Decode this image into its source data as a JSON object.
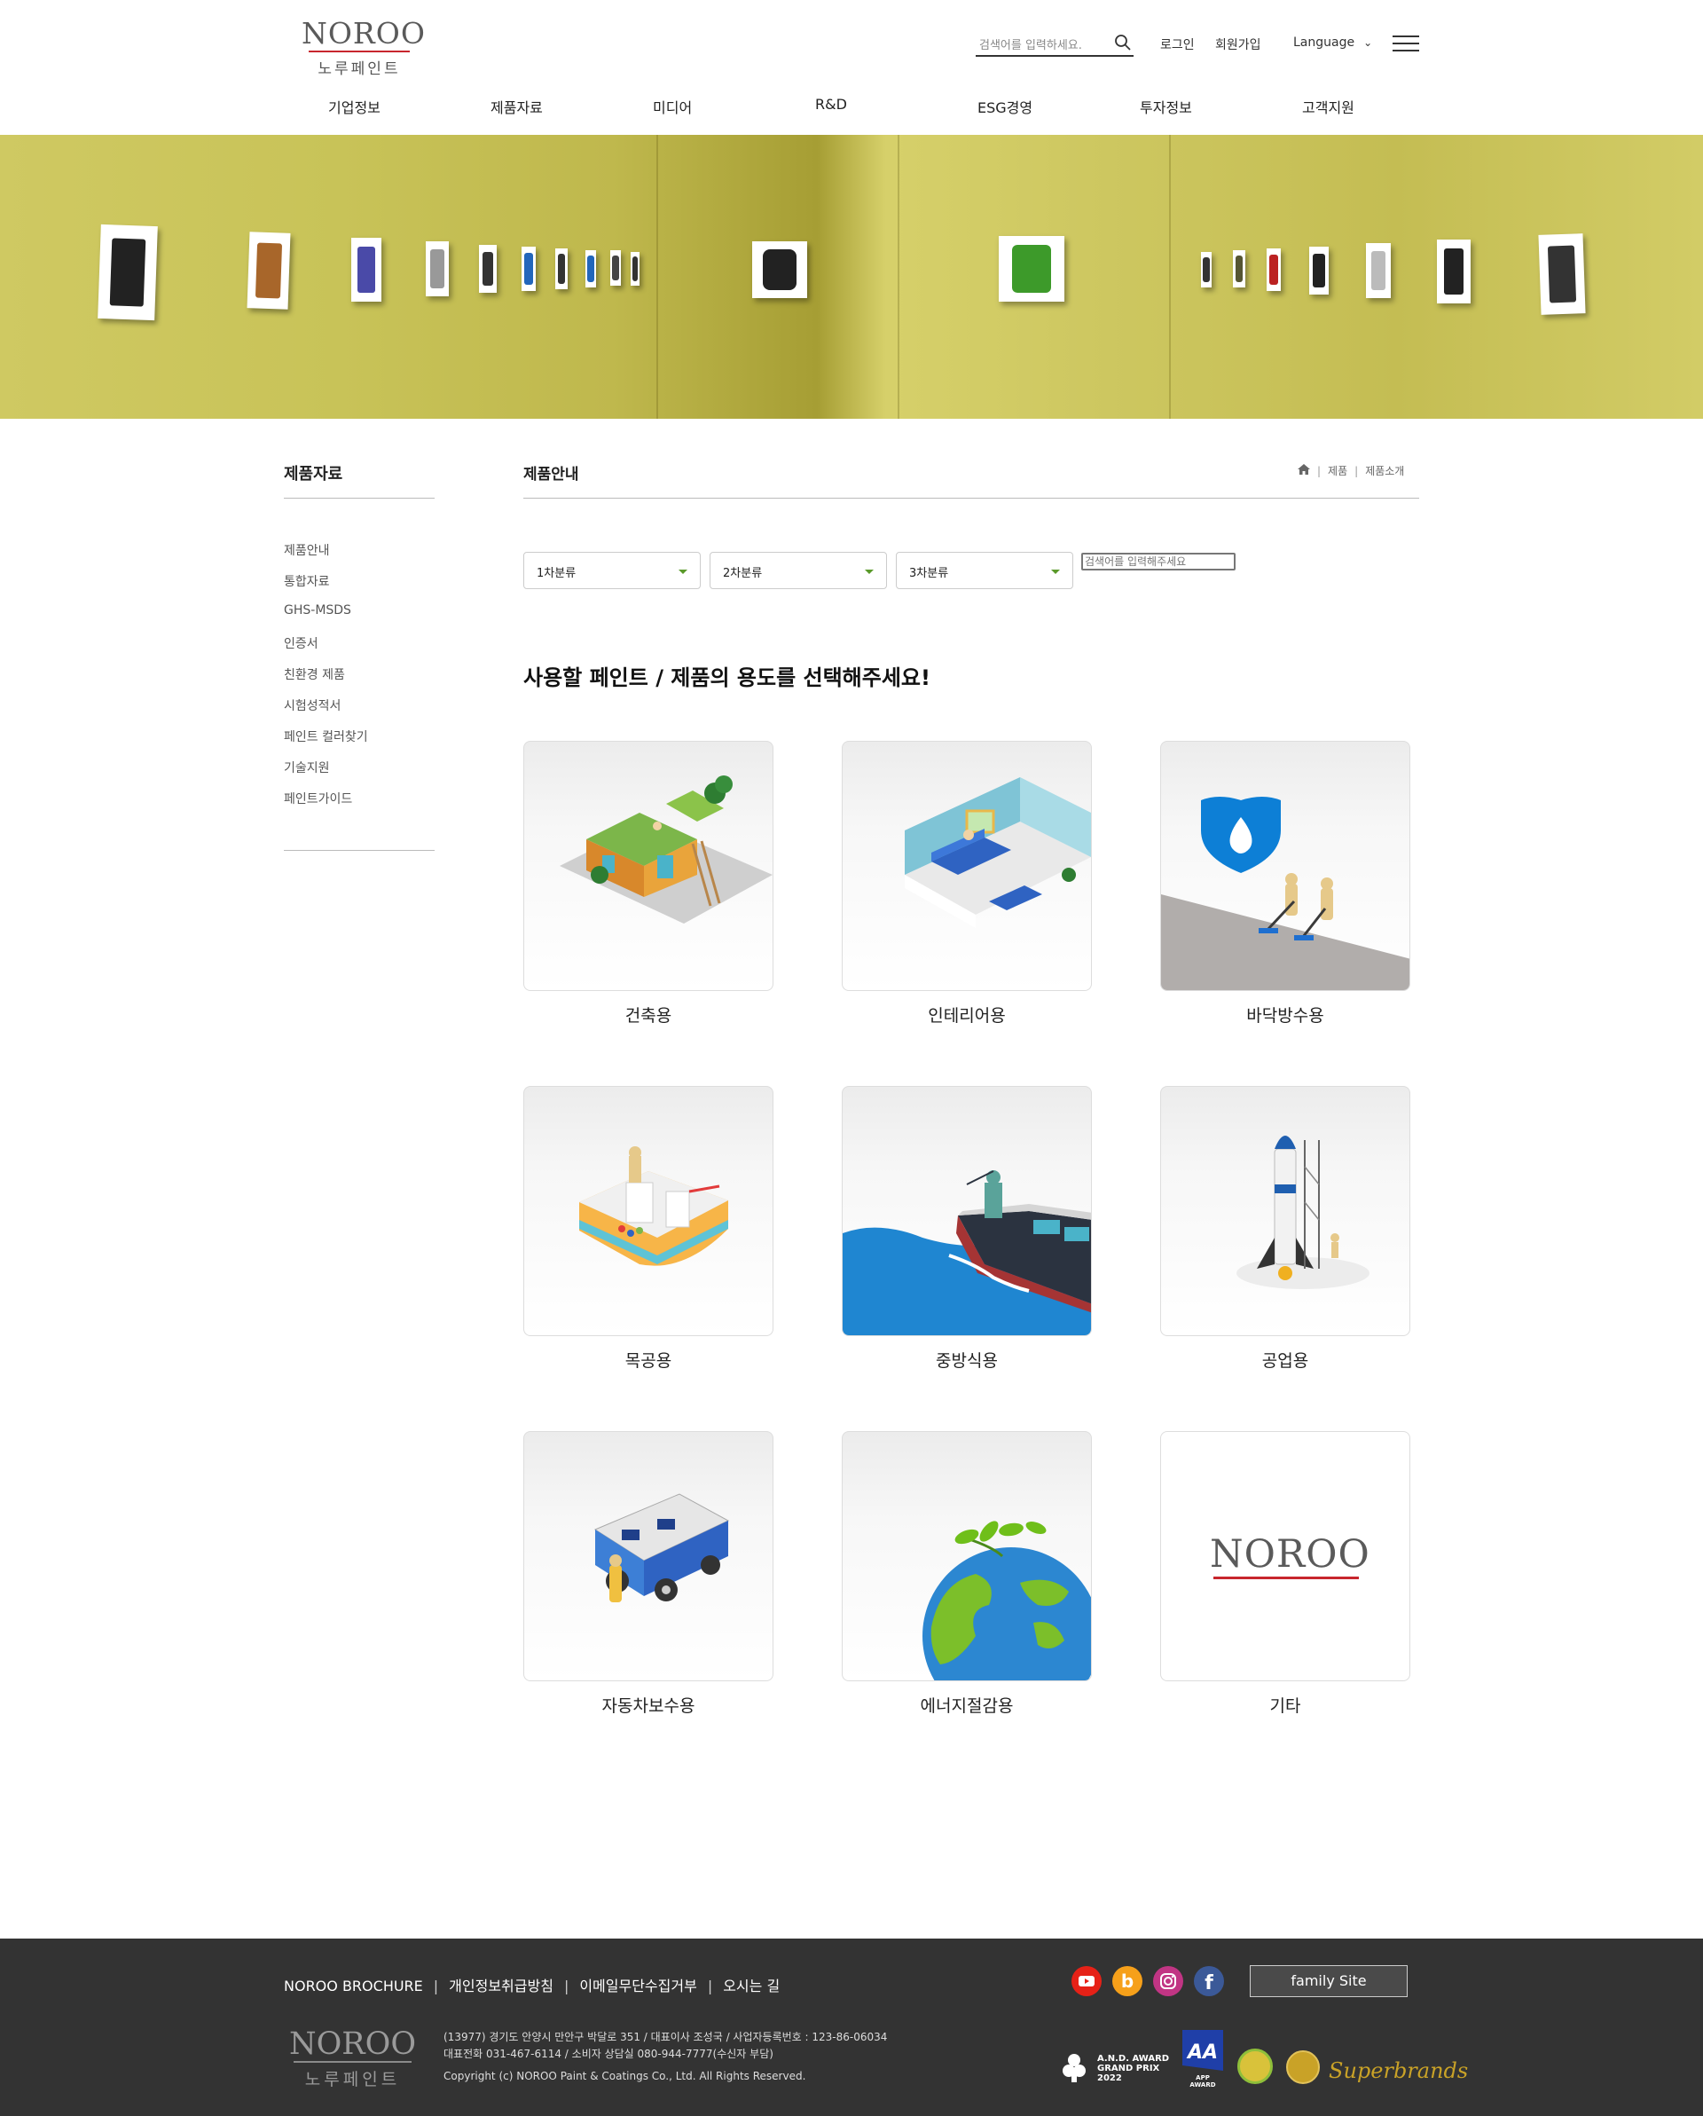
{
  "header": {
    "logo_word": "NOROO",
    "logo_ko": "노루페인트",
    "search_placeholder": "검색어를 입력하세요.",
    "login": "로그인",
    "join": "회원가입",
    "language": "Language",
    "nav": [
      "기업정보",
      "제품자료",
      "미디어",
      "R&D",
      "ESG경영",
      "투자정보",
      "고객지원"
    ]
  },
  "lnb": {
    "title": "제품자료",
    "items": [
      "제품안내",
      "통합자료",
      "GHS-MSDS",
      "인증서",
      "친환경 제품",
      "시험성적서",
      "페인트 컬러찾기",
      "기술지원",
      "페인트가이드"
    ]
  },
  "content": {
    "title": "제품안내",
    "breadcrumb": [
      "제품",
      "제품소개"
    ],
    "filters": [
      "1차분류",
      "2차분류",
      "3차분류"
    ],
    "search_placeholder": "검색어를 입력해주세요",
    "headline": "사용할 페인트 / 제품의 용도를 선택해주세요!",
    "categories": [
      {
        "label": "건축용",
        "icon": "house-construction-icon"
      },
      {
        "label": "인테리어용",
        "icon": "living-room-icon"
      },
      {
        "label": "바닥방수용",
        "icon": "waterproof-floor-icon"
      },
      {
        "label": "목공용",
        "icon": "woodwork-icon"
      },
      {
        "label": "중방식용",
        "icon": "ship-icon"
      },
      {
        "label": "공업용",
        "icon": "rocket-icon"
      },
      {
        "label": "자동차보수용",
        "icon": "car-icon"
      },
      {
        "label": "에너지절감용",
        "icon": "earth-icon"
      },
      {
        "label": "기타",
        "icon": "noroo-logo-icon"
      }
    ],
    "other_logo": "NOROO"
  },
  "footer": {
    "links": [
      "NOROO BROCHURE",
      "개인정보취급방침",
      "이메일무단수집거부",
      "오시는 길"
    ],
    "family_site": "family Site",
    "logo_word": "NOROO",
    "logo_ko": "노루페인트",
    "address": "(13977) 경기도 안양시 만안구 박달로 351 / 대표이사 조성국 / 사업자등록번호 : 123-86-06034",
    "phone": "대표전화 031-467-6114 / 소비자 상담실 080-944-7777(수신자 부담)",
    "copyright": "Copyright (c) NOROO Paint & Coatings Co., Ltd. All Rights Reserved.",
    "award_lines": [
      "A.N.D. AWARD",
      "GRAND PRIX",
      "2022"
    ],
    "app_award": "APP AWARD",
    "superbrands": "Superbrands",
    "sns": [
      "youtube-icon",
      "blog-icon",
      "instagram-icon",
      "facebook-icon"
    ],
    "colors": {
      "youtube": "#e62117",
      "blog": "#f6a01a",
      "instagram": "#c13584",
      "facebook": "#3b5998"
    }
  }
}
